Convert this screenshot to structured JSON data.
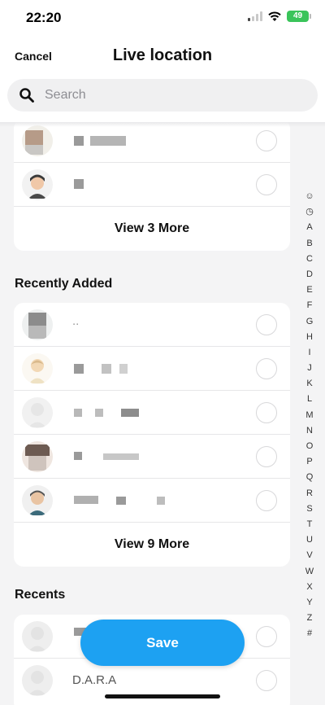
{
  "status": {
    "time": "22:20",
    "battery": "49"
  },
  "header": {
    "cancel_label": "Cancel",
    "title": "Live location"
  },
  "search": {
    "placeholder": "Search"
  },
  "top_group": {
    "view_more_label": "View 3 More"
  },
  "recently_added": {
    "title": "Recently Added",
    "view_more_label": "View 9 More"
  },
  "recents": {
    "title": "Recents",
    "items": [
      {
        "name": "D.A.R.A"
      }
    ]
  },
  "index": [
    "☺",
    "◷",
    "A",
    "B",
    "C",
    "D",
    "E",
    "F",
    "G",
    "H",
    "I",
    "J",
    "K",
    "L",
    "M",
    "N",
    "O",
    "P",
    "Q",
    "R",
    "S",
    "T",
    "U",
    "V",
    "W",
    "X",
    "Y",
    "Z",
    "#"
  ],
  "save_label": "Save",
  "colors": {
    "accent": "#1da1f2",
    "background": "#f4f4f5",
    "card": "#ffffff"
  }
}
